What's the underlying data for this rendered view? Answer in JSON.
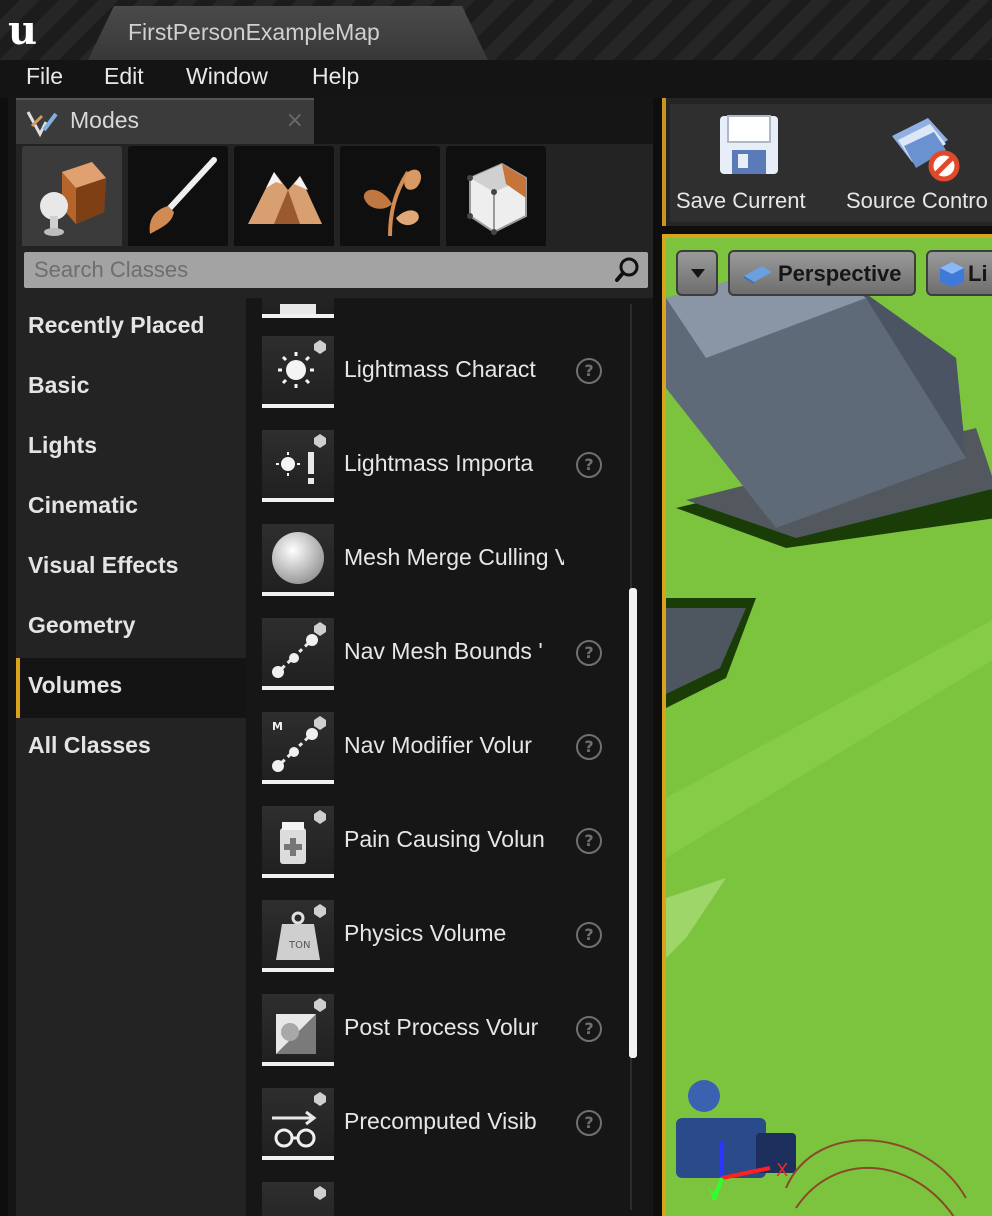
{
  "window": {
    "logo": "u",
    "document_tab": "FirstPersonExampleMap"
  },
  "menu": [
    "File",
    "Edit",
    "Window",
    "Help"
  ],
  "modes_panel": {
    "tab_label": "Modes",
    "close_glyph": "×",
    "mode_icons": [
      "place-mode-icon",
      "paint-mode-icon",
      "landscape-mode-icon",
      "foliage-mode-icon",
      "geometry-edit-mode-icon"
    ],
    "search_placeholder": "Search Classes",
    "categories": [
      "Recently Placed",
      "Basic",
      "Lights",
      "Cinematic",
      "Visual Effects",
      "Geometry",
      "Volumes",
      "All Classes"
    ],
    "selected_category": "Volumes",
    "classes": [
      {
        "name": "Lightmass Charact",
        "icon": "lightmass-character-icon",
        "help": "?"
      },
      {
        "name": "Lightmass Importa",
        "icon": "lightmass-importance-icon",
        "help": "?"
      },
      {
        "name": "Mesh Merge Culling Vc",
        "icon": "sphere-icon",
        "help": ""
      },
      {
        "name": "Nav Mesh Bounds '",
        "icon": "nav-mesh-icon",
        "help": "?"
      },
      {
        "name": "Nav Modifier Volur",
        "icon": "nav-modifier-icon",
        "help": "?"
      },
      {
        "name": "Pain Causing Volun",
        "icon": "pain-causing-icon",
        "help": "?"
      },
      {
        "name": "Physics Volume",
        "icon": "physics-weight-icon",
        "help": "?"
      },
      {
        "name": "Post Process Volur",
        "icon": "post-process-icon",
        "help": "?"
      },
      {
        "name": "Precomputed Visib",
        "icon": "precomputed-visibility-icon",
        "help": "?"
      }
    ]
  },
  "toolbar": {
    "save_label": "Save Current",
    "source_control_label": "Source Contro"
  },
  "viewport": {
    "view_mode": "Perspective",
    "lit_label": "Li",
    "axis_x": "X",
    "axis_y": "Y"
  },
  "colors": {
    "accent": "#d9a320",
    "ground": "#7cc43c"
  }
}
